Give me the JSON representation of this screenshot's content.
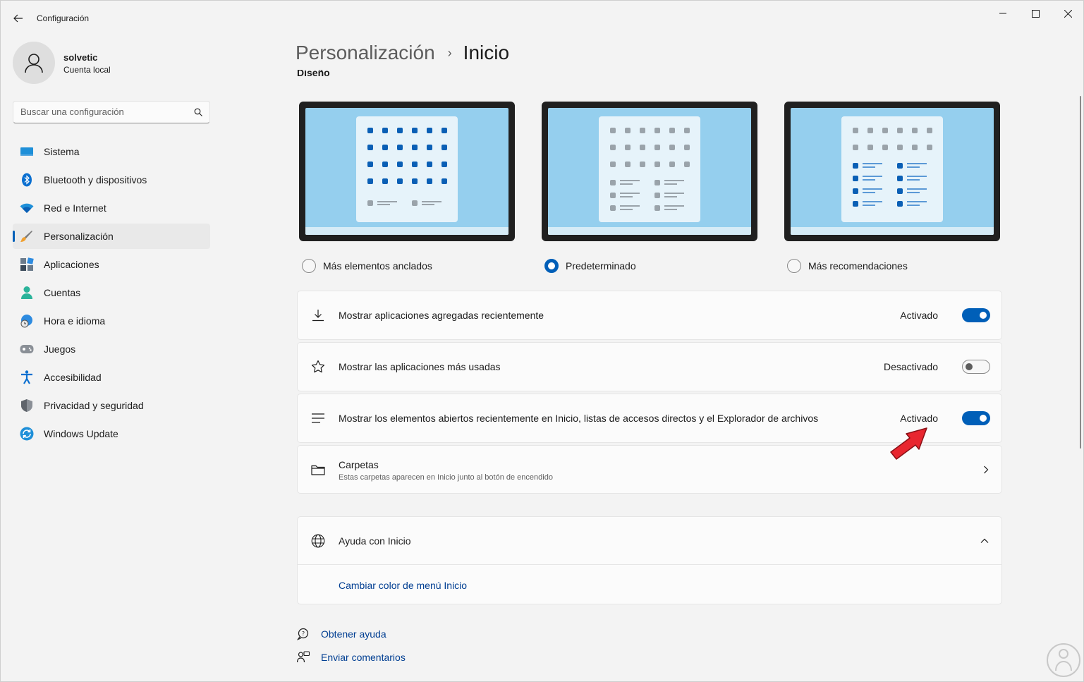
{
  "app": {
    "title": "Configuración"
  },
  "user": {
    "name": "solvetic",
    "account_type": "Cuenta local"
  },
  "search": {
    "placeholder": "Buscar una configuración"
  },
  "sidebar": {
    "items": [
      {
        "label": "Sistema",
        "icon": "system-icon"
      },
      {
        "label": "Bluetooth y dispositivos",
        "icon": "bluetooth-icon"
      },
      {
        "label": "Red e Internet",
        "icon": "wifi-icon"
      },
      {
        "label": "Personalización",
        "icon": "brush-icon",
        "active": true
      },
      {
        "label": "Aplicaciones",
        "icon": "apps-icon"
      },
      {
        "label": "Cuentas",
        "icon": "person-icon"
      },
      {
        "label": "Hora e idioma",
        "icon": "globe-clock-icon"
      },
      {
        "label": "Juegos",
        "icon": "gamepad-icon"
      },
      {
        "label": "Accesibilidad",
        "icon": "accessibility-icon"
      },
      {
        "label": "Privacidad y seguridad",
        "icon": "shield-icon"
      },
      {
        "label": "Windows Update",
        "icon": "update-icon"
      }
    ]
  },
  "breadcrumb": {
    "parent": "Personalización",
    "separator": "›",
    "current": "Inicio"
  },
  "layout": {
    "section_title": "Diseño",
    "options": [
      {
        "label": "Más elementos anclados",
        "selected": false
      },
      {
        "label": "Predeterminado",
        "selected": true
      },
      {
        "label": "Más recomendaciones",
        "selected": false
      }
    ]
  },
  "settings": {
    "recent_apps": {
      "label": "Mostrar aplicaciones agregadas recientemente",
      "state": "Activado",
      "on": true
    },
    "most_used": {
      "label": "Mostrar las aplicaciones más usadas",
      "state": "Desactivado",
      "on": false
    },
    "recent_items": {
      "label": "Mostrar los elementos abiertos recientemente en Inicio, listas de accesos directos y el Explorador de archivos",
      "state": "Activado",
      "on": true
    },
    "folders": {
      "title": "Carpetas",
      "description": "Estas carpetas aparecen en Inicio junto al botón de encendido"
    }
  },
  "help": {
    "title": "Ayuda con Inicio",
    "link": "Cambiar color de menú Inicio"
  },
  "footer": {
    "get_help": "Obtener ayuda",
    "feedback": "Enviar comentarios"
  },
  "colors": {
    "accent": "#005fb8",
    "link": "#003e92",
    "background": "#f3f3f3",
    "card": "#fbfbfb",
    "annotation_arrow": "#e8262f"
  }
}
